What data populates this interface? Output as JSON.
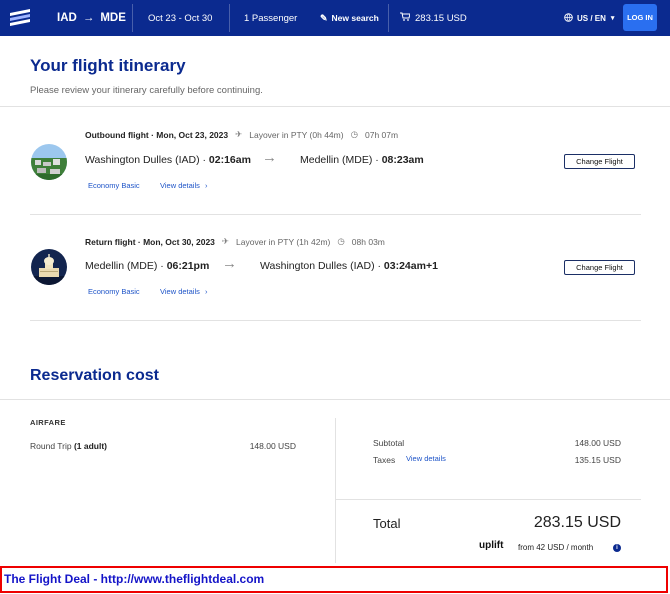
{
  "header": {
    "origin": "IAD",
    "destination": "MDE",
    "dates": "Oct 23 - Oct 30",
    "passengers": "1 Passenger",
    "new_search": "New search",
    "cart_total": "283.15 USD",
    "locale": "US / EN",
    "login": "LOG IN",
    "colors": {
      "bar": "#0b2a8f",
      "login": "#2a6ff0"
    }
  },
  "page": {
    "title": "Your flight itinerary",
    "subtitle": "Please review your itinerary carefully before continuing."
  },
  "flights": [
    {
      "label": "Outbound flight",
      "date": "Mon, Oct 23, 2023",
      "layover": "Layover in PTY (0h 44m)",
      "duration": "07h 07m",
      "from_city": "Washington Dulles (IAD)",
      "from_time": "02:16am",
      "to_city": "Medellin (MDE)",
      "to_time": "08:23am",
      "fare": "Economy Basic",
      "details": "View details",
      "change": "Change Flight",
      "thumb_icon": "landscape-photo"
    },
    {
      "label": "Return flight",
      "date": "Mon, Oct 30, 2023",
      "layover": "Layover in PTY (1h 42m)",
      "duration": "08h 03m",
      "from_city": "Medellin (MDE)",
      "from_time": "06:21pm",
      "to_city": "Washington Dulles (IAD)",
      "to_time": "03:24am+1",
      "fare": "Economy Basic",
      "details": "View details",
      "change": "Change Flight",
      "thumb_icon": "capitol-night-photo"
    }
  ],
  "reservation": {
    "title": "Reservation cost",
    "airfare_label": "AIRFARE",
    "trip_prefix": "Round Trip ",
    "trip_count": "(1 adult)",
    "trip_amount": "148.00 USD",
    "subtotal_label": "Subtotal",
    "subtotal_amount": "148.00 USD",
    "taxes_label": "Taxes",
    "taxes_link": "View details",
    "taxes_amount": "135.15 USD",
    "total_label": "Total",
    "total_amount": "283.15 USD",
    "uplift_brand": "uplift",
    "uplift_text": "from 42 USD / month"
  },
  "footer": {
    "text": "The Flight Deal - http://www.theflightdeal.com"
  }
}
